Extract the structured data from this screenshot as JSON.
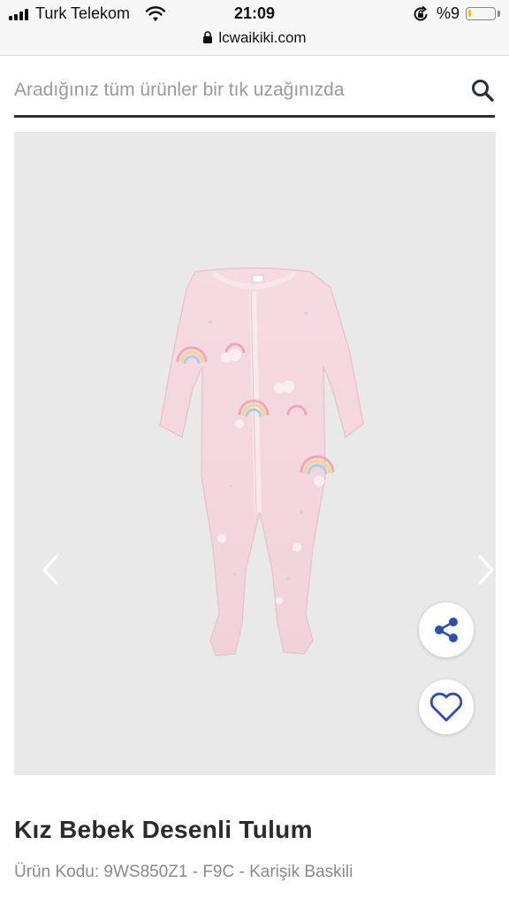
{
  "status_bar": {
    "carrier": "Turk Telekom",
    "time": "21:09",
    "battery_percent": "%9",
    "battery_level": 0.09,
    "icons": [
      "signal-icon",
      "wifi-icon",
      "rotation-lock-icon",
      "battery-icon"
    ]
  },
  "browser": {
    "url": "lcwaikiki.com",
    "icons": [
      "lock-icon"
    ]
  },
  "search": {
    "placeholder": "Aradığınız tüm ürünler bir tık uzağınızda",
    "value": "",
    "icons": [
      "search-icon"
    ]
  },
  "gallery": {
    "icons": [
      "chevron-left-icon",
      "chevron-right-icon",
      "share-icon",
      "heart-icon"
    ],
    "accent_color": "#2f4db7"
  },
  "product": {
    "title": "Kız Bebek Desenli Tulum",
    "code_line": "Ürün Kodu: 9WS850Z1 - F9C - Karişik Baskili"
  }
}
